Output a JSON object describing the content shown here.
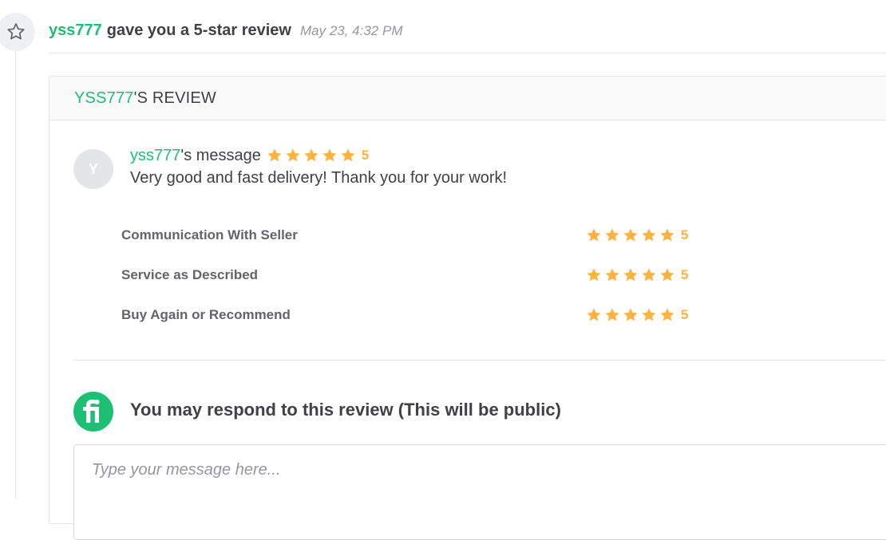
{
  "event": {
    "username": "yss777",
    "action": "gave you a 5-star review",
    "time": "May 23, 4:32 PM",
    "icon": "star-outline-icon"
  },
  "review": {
    "header_user": "YSS777",
    "header_suffix": "'S REVIEW",
    "avatar_initial": "Y",
    "message_user": "yss777",
    "message_suffix": "'s message",
    "overall_rating": "5",
    "message": "Very good and fast delivery! Thank you for your work!",
    "ratings": [
      {
        "label": "Communication With Seller",
        "value": "5"
      },
      {
        "label": "Service as Described",
        "value": "5"
      },
      {
        "label": "Buy Again or Recommend",
        "value": "5"
      }
    ]
  },
  "respond": {
    "title": "You may respond to this review (This will be public)",
    "placeholder": "Type your message here...",
    "logo_icon": "fiverr-logo-icon"
  },
  "colors": {
    "brand_green": "#1dbf73",
    "star": "#ffb33e",
    "text_dark": "#404145",
    "text_muted": "#62646a"
  }
}
